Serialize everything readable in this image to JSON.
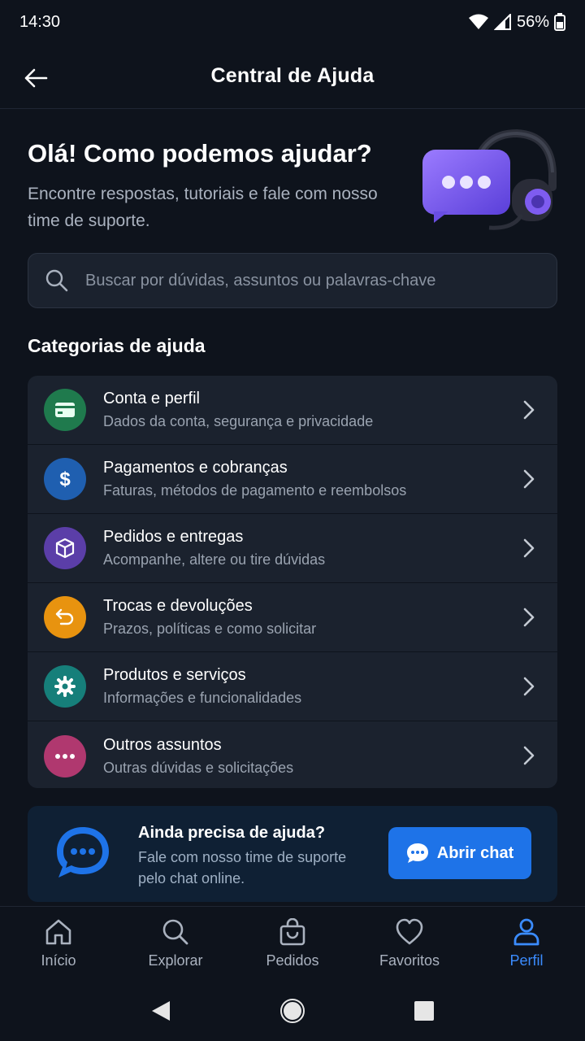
{
  "status": {
    "time": "14:30",
    "battery": "56%"
  },
  "header": {
    "title": "Central de Ajuda",
    "back_icon": "arrow-left-icon"
  },
  "hero": {
    "title": "Olá! Como podemos ajudar?",
    "subtitle": "Encontre respostas, tutoriais e fale com nosso time de suporte.",
    "illustration": "chat-bubble-headset-icon"
  },
  "search": {
    "placeholder": "Buscar por dúvidas, assuntos ou palavras-chave",
    "icon": "search-icon"
  },
  "categories_title": "Categorias de ajuda",
  "categories": [
    {
      "title": "Conta e perfil",
      "subtitle": "Dados da conta, segurança e privacidade",
      "icon": "card-icon",
      "color": "#1f7a4d"
    },
    {
      "title": "Pagamentos e cobranças",
      "subtitle": "Faturas, métodos de pagamento e reembolsos",
      "icon": "dollar-icon",
      "color": "#1f5fb0"
    },
    {
      "title": "Pedidos e entregas",
      "subtitle": "Acompanhe, altere ou tire dúvidas",
      "icon": "box-icon",
      "color": "#5b3ea8"
    },
    {
      "title": "Trocas e devoluções",
      "subtitle": "Prazos, políticas e como solicitar",
      "icon": "return-icon",
      "color": "#e8930f"
    },
    {
      "title": "Produtos e serviços",
      "subtitle": "Informações e funcionalidades",
      "icon": "gear-icon",
      "color": "#167f7a"
    },
    {
      "title": "Outros assuntos",
      "subtitle": "Outras dúvidas e solicitações",
      "icon": "more-icon",
      "color": "#b0386f"
    }
  ],
  "help_card": {
    "title": "Ainda precisa de ajuda?",
    "subtitle": "Fale com nosso time de suporte pelo chat online.",
    "button_label": "Abrir chat"
  },
  "nav": {
    "items": [
      {
        "label": "Início",
        "icon": "home-icon"
      },
      {
        "label": "Explorar",
        "icon": "search-icon"
      },
      {
        "label": "Pedidos",
        "icon": "bag-icon"
      },
      {
        "label": "Favoritos",
        "icon": "heart-icon"
      },
      {
        "label": "Perfil",
        "icon": "person-icon"
      }
    ],
    "active": "Perfil"
  },
  "colors": {
    "accent": "#3b8cff",
    "button": "#1e73e8",
    "background": "#0e131c",
    "card": "#1b222e"
  }
}
